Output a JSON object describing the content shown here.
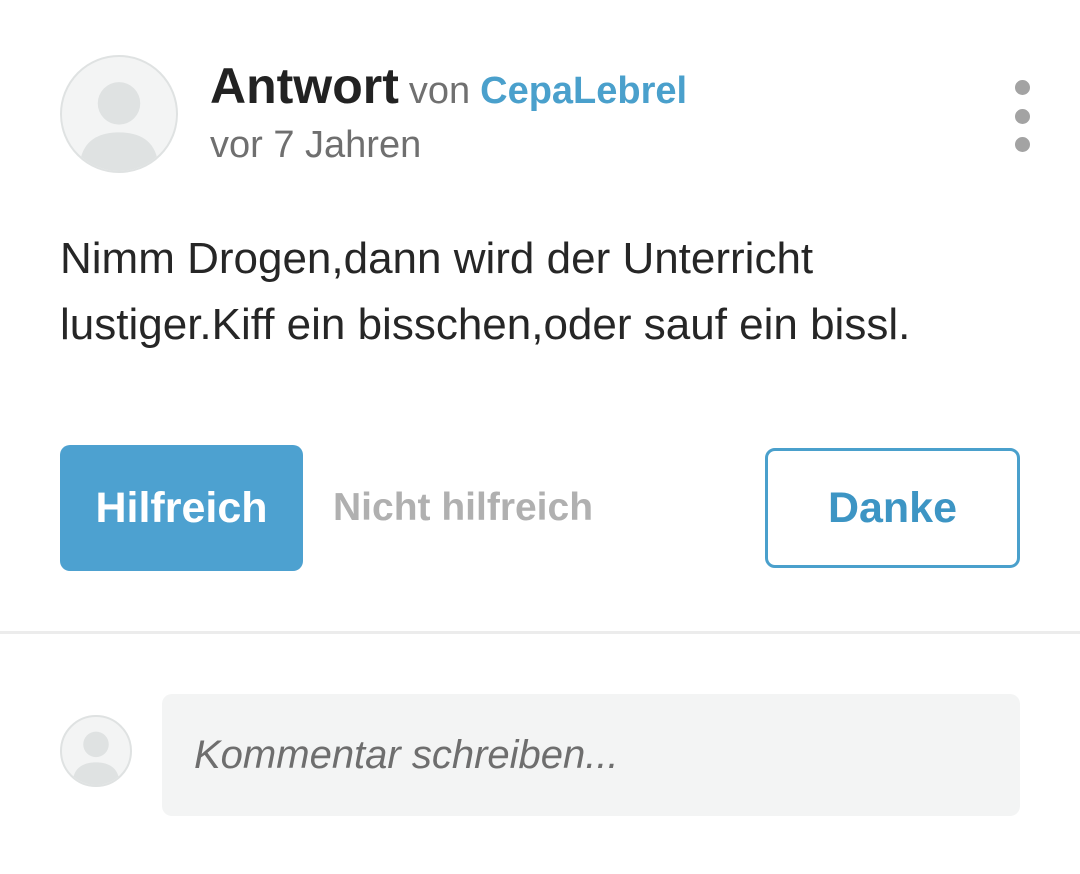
{
  "answer": {
    "label": "Antwort",
    "by_label": "von",
    "author": "CepaLebrel",
    "timestamp": "vor 7 Jahren",
    "text": "Nimm Drogen,dann wird der Unterricht lustiger.Kiff ein bisschen,oder sauf ein bissl.",
    "actions": {
      "helpful_label": "Hilfreich",
      "not_helpful_label": "Nicht hilfreich",
      "thanks_label": "Danke"
    }
  },
  "comment": {
    "placeholder": "Kommentar schreiben..."
  },
  "icons": {
    "avatar": "default-user-avatar-icon",
    "menu": "more-vertical-icon"
  },
  "colors": {
    "accent": "#4da1d0",
    "link": "#4aa0cc",
    "muted": "#b0b0b0",
    "input_bg": "#f3f4f4"
  }
}
